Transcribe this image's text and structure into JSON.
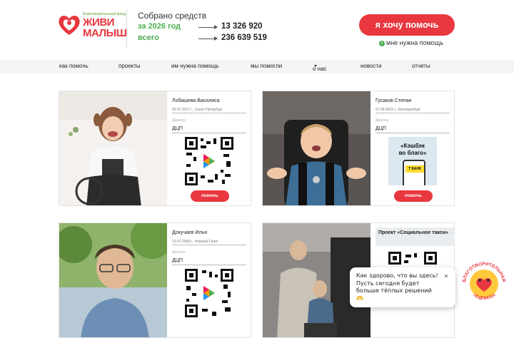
{
  "header": {
    "logo": {
      "tagline": "Благотворительный фонд",
      "line1": "ЖИВИ",
      "line2": "МАЛЫШ"
    },
    "collected_label": "Собрано средств",
    "year_label": "за 2026 год",
    "year_amount": "13 326 920",
    "total_label": "всего",
    "total_amount": "236 639 519",
    "help_button": "я хочу помочь",
    "need_help_link": "мне нужна помощь"
  },
  "nav": {
    "items": [
      {
        "label": "как помочь"
      },
      {
        "label": "проекты"
      },
      {
        "label": "им нужна помощь"
      },
      {
        "label": "мы помогли"
      },
      {
        "label": "о нас"
      },
      {
        "label": "новости"
      },
      {
        "label": "отчеты"
      }
    ]
  },
  "cards": [
    {
      "name": "Лобашева Василиса",
      "meta": "05.07.2017 г., Санкт-Петербург",
      "diag_label": "Диагноз",
      "diag": "ДЦП",
      "button": "помочь"
    },
    {
      "name": "Гусаков Степан",
      "meta": "07.09.2022 г., Екатеринбург",
      "diag_label": "Диагноз",
      "diag": "ДЦП",
      "button": "помочь",
      "ad_line1": "«Кэшбэк",
      "ad_line2": "во благо»",
      "ad_brand": "Т БАНК"
    },
    {
      "name": "Докучаев Илья",
      "meta": "13.07.2008 г., Нижний Тагил",
      "diag_label": "Диагноз",
      "diag": "ДЦП"
    },
    {
      "project_title": "Проект «Социальное такси»"
    }
  ],
  "popup": {
    "text": "Как здорово, что вы здесь! Пусть сегодня будет больше тёплых решений 🫶",
    "close": "×"
  },
  "badge": {
    "text": "БЛАГОТВОРИТЕЛЬНАЯ ПОДПИСКА"
  },
  "colors": {
    "brand_red": "#e8373e",
    "brand_green": "#4caf50",
    "nav_bg": "#f3f5f7"
  }
}
